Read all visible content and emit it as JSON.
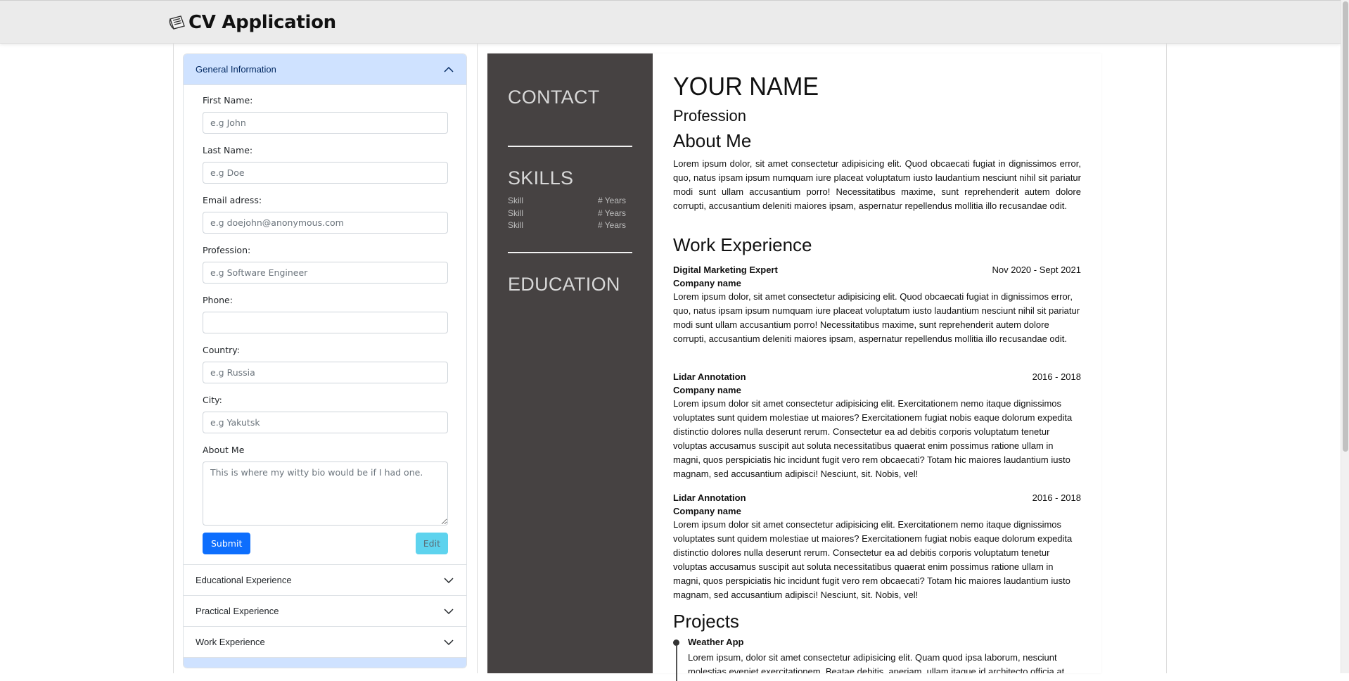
{
  "app": {
    "title": "CV Application",
    "brand_icon": "newspaper-icon"
  },
  "form": {
    "sections": {
      "general": "General Information",
      "educational": "Educational Experience",
      "practical": "Practical Experience",
      "work": "Work Experience"
    },
    "fields": {
      "first_name": {
        "label": "First Name:",
        "placeholder": "e.g John",
        "value": ""
      },
      "last_name": {
        "label": "Last Name:",
        "placeholder": "e.g Doe",
        "value": ""
      },
      "email": {
        "label": "Email adress:",
        "placeholder": "e.g doejohn@anonymous.com",
        "value": ""
      },
      "profession": {
        "label": "Profession:",
        "placeholder": "e.g Software Engineer",
        "value": ""
      },
      "phone": {
        "label": "Phone:",
        "placeholder": "",
        "value": ""
      },
      "country": {
        "label": "Country:",
        "placeholder": "e.g Russia",
        "value": ""
      },
      "city": {
        "label": "City:",
        "placeholder": "e.g Yakutsk",
        "value": ""
      },
      "about": {
        "label": "About Me",
        "placeholder": "This is where my witty bio would be if I had one.",
        "value": ""
      }
    },
    "buttons": {
      "submit": "Submit",
      "edit": "Edit"
    }
  },
  "cv": {
    "sidebar": {
      "contact": "CONTACT",
      "skills": "SKILLS",
      "education": "EDUCATION",
      "skill_rows": [
        {
          "name": "Skill",
          "years": "# Years"
        },
        {
          "name": "Skill",
          "years": "# Years"
        },
        {
          "name": "Skill",
          "years": "# Years"
        }
      ]
    },
    "name": "YOUR NAME",
    "profession": "Profession",
    "about_heading": "About Me",
    "about_text": "Lorem ipsum dolor, sit amet consectetur adipisicing elit. Quod obcaecati fugiat in dignissimos error, quo, natus ipsam ipsum numquam iure placeat voluptatum iusto laudantium nesciunt nihil sit pariatur modi sunt ullam accusantium porro! Necessitatibus maxime, sunt reprehenderit autem dolore corrupti, accusantium deleniti maiores ipsam, aspernatur repellendus mollitia illo recusandae odit.",
    "work_heading": "Work Experience",
    "jobs": [
      {
        "title": "Digital Marketing Expert",
        "dates": "Nov 2020 - Sept 2021",
        "company": "Company name",
        "text": "Lorem ipsum dolor, sit amet consectetur adipisicing elit. Quod obcaecati fugiat in dignissimos error, quo, natus ipsam ipsum numquam iure placeat voluptatum iusto laudantium nesciunt nihil sit pariatur modi sunt ullam accusantium porro! Necessitatibus maxime, sunt reprehenderit autem dolore corrupti, accusantium deleniti maiores ipsam, aspernatur repellendus mollitia illo recusandae odit."
      },
      {
        "title": "Lidar Annotation",
        "dates": "2016 - 2018",
        "company": "Company name",
        "text": "Lorem ipsum dolor sit amet consectetur adipisicing elit. Exercitationem nemo itaque dignissimos voluptates sunt quidem molestiae ut maiores? Exercitationem fugiat nobis eaque dolorum expedita distinctio dolores nulla deserunt rerum. Consectetur ea ad debitis corporis voluptatum tenetur voluptas accusamus suscipit aut soluta necessitatibus quaerat enim possimus ratione ullam in magni, quos perspiciatis hic incidunt fugit vero rem obcaecati? Totam hic maiores laudantium iusto magnam, sed accusantium adipisci! Nesciunt, sit. Nobis, vel!"
      },
      {
        "title": "Lidar Annotation",
        "dates": "2016 - 2018",
        "company": "Company name",
        "text": "Lorem ipsum dolor sit amet consectetur adipisicing elit. Exercitationem nemo itaque dignissimos voluptates sunt quidem molestiae ut maiores? Exercitationem fugiat nobis eaque dolorum expedita distinctio dolores nulla deserunt rerum. Consectetur ea ad debitis corporis voluptatum tenetur voluptas accusamus suscipit aut soluta necessitatibus quaerat enim possimus ratione ullam in magni, quos perspiciatis hic incidunt fugit vero rem obcaecati? Totam hic maiores laudantium iusto magnam, sed accusantium adipisci! Nesciunt, sit. Nobis, vel!"
      }
    ],
    "projects_heading": "Projects",
    "projects": [
      {
        "title": "Weather App",
        "text": "Lorem ipsum, dolor sit amet consectetur adipisicing elit. Quam quod ipsa laborum, nesciunt molestias eveniet exercitationem. Beatae debitis, aperiam, ullam itaque id architecto officia at"
      }
    ]
  },
  "colors": {
    "cv_sidebar_bg": "#464242",
    "accordion_active_bg": "#cfe2ff",
    "primary_button": "#0d6efd",
    "info_button": "#5ed3ee"
  }
}
